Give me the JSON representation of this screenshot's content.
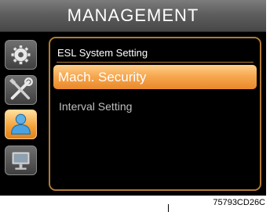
{
  "header": {
    "title": "MANAGEMENT"
  },
  "sidebar": {
    "items": [
      {
        "icon": "gear-icon",
        "active": false
      },
      {
        "icon": "tools-icon",
        "active": false
      },
      {
        "icon": "user-icon",
        "active": true
      },
      {
        "icon": "monitor-icon",
        "active": false
      }
    ]
  },
  "panel": {
    "header": "ESL System Setting",
    "items": [
      {
        "label": "Mach. Security",
        "selected": true
      },
      {
        "label": "Interval Setting",
        "selected": false
      }
    ]
  },
  "caption": "75793CD26C",
  "colors": {
    "accent": "#f7a850",
    "panel_border": "#b07a35",
    "background": "#000000"
  }
}
